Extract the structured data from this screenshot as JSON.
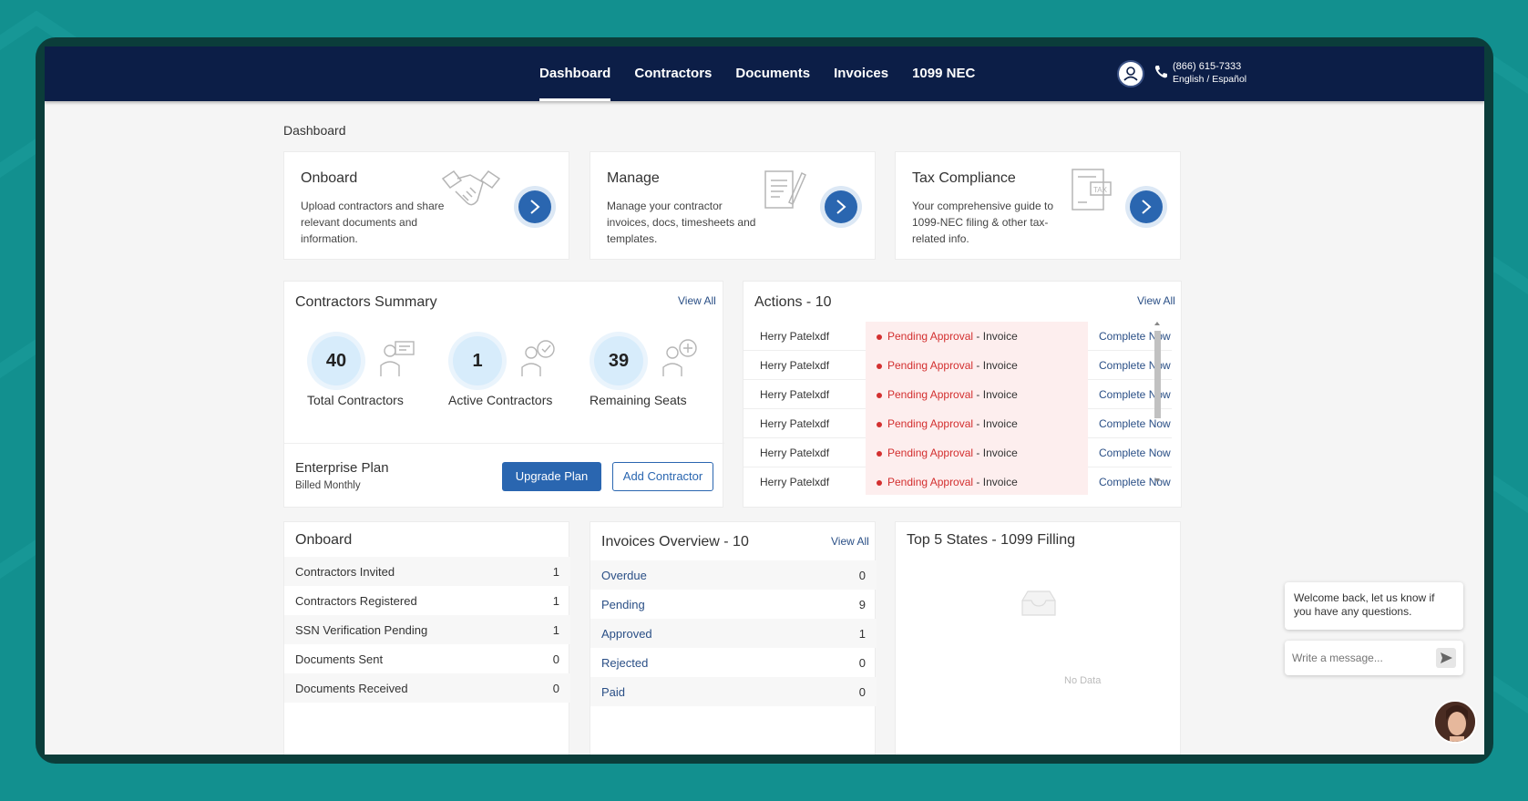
{
  "nav": {
    "links": [
      "Dashboard",
      "Contractors",
      "Documents",
      "Invoices",
      "1099 NEC"
    ],
    "active": "Dashboard",
    "phone": "(866) 615-7333",
    "language": "English / Español"
  },
  "breadcrumb": "Dashboard",
  "cards": [
    {
      "title": "Onboard",
      "description": "Upload contractors and share relevant documents and information."
    },
    {
      "title": "Manage",
      "description": "Manage your contractor invoices, docs, timesheets and templates."
    },
    {
      "title": "Tax Compliance",
      "description": "Your comprehensive guide to 1099-NEC filing & other tax-related info."
    }
  ],
  "contractors_summary": {
    "title": "Contractors Summary",
    "view_all": "View All",
    "stats": [
      {
        "value": "40",
        "label": "Total Contractors"
      },
      {
        "value": "1",
        "label": "Active Contractors"
      },
      {
        "value": "39",
        "label": "Remaining Seats"
      }
    ],
    "plan_name": "Enterprise Plan",
    "plan_billing": "Billed Monthly",
    "upgrade_label": "Upgrade Plan",
    "add_label": "Add Contractor"
  },
  "actions": {
    "title": "Actions - 10",
    "view_all": "View All",
    "rows": [
      {
        "name": "Herry Patelxdf",
        "status": "Pending Approval",
        "type": " - Invoice",
        "link": "Complete Now"
      },
      {
        "name": "Herry Patelxdf",
        "status": "Pending Approval",
        "type": " - Invoice",
        "link": "Complete Now"
      },
      {
        "name": "Herry Patelxdf",
        "status": "Pending Approval",
        "type": " - Invoice",
        "link": "Complete Now"
      },
      {
        "name": "Herry Patelxdf",
        "status": "Pending Approval",
        "type": " - Invoice",
        "link": "Complete Now"
      },
      {
        "name": "Herry Patelxdf",
        "status": "Pending Approval",
        "type": " - Invoice",
        "link": "Complete Now"
      },
      {
        "name": "Herry Patelxdf",
        "status": "Pending Approval",
        "type": " - Invoice",
        "link": "Complete Now"
      }
    ]
  },
  "onboard": {
    "title": "Onboard",
    "rows": [
      {
        "label": "Contractors Invited",
        "value": "1"
      },
      {
        "label": "Contractors Registered",
        "value": "1"
      },
      {
        "label": "SSN Verification Pending",
        "value": "1"
      },
      {
        "label": "Documents Sent",
        "value": "0"
      },
      {
        "label": "Documents Received",
        "value": "0"
      }
    ]
  },
  "invoices": {
    "title": "Invoices Overview - 10",
    "view_all": "View All",
    "rows": [
      {
        "label": "Overdue",
        "value": "0"
      },
      {
        "label": "Pending",
        "value": "9"
      },
      {
        "label": "Approved",
        "value": "1"
      },
      {
        "label": "Rejected",
        "value": "0"
      },
      {
        "label": "Paid",
        "value": "0"
      }
    ]
  },
  "top_states": {
    "title": "Top 5 States - 1099 Filling",
    "empty": "No Data"
  },
  "chat": {
    "welcome": "Welcome back, let us know if you have any questions.",
    "placeholder": "Write a message..."
  }
}
